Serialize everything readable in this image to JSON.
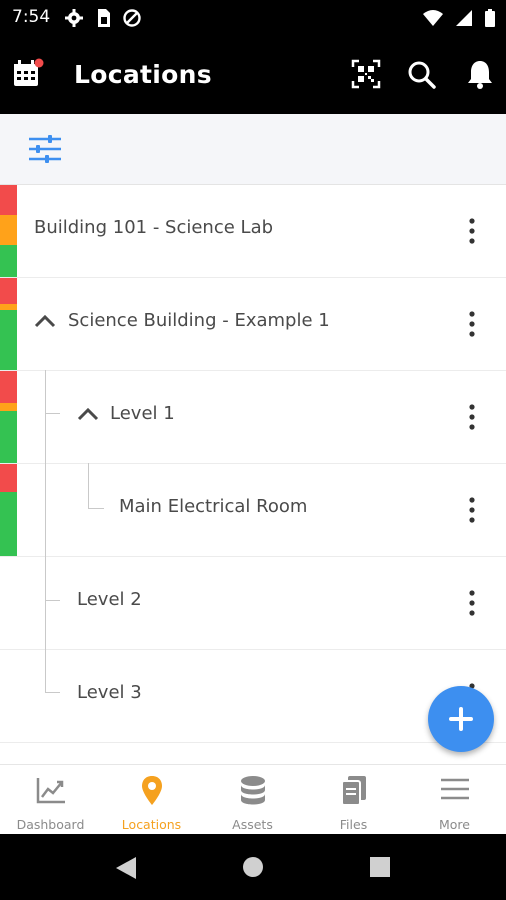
{
  "status_bar": {
    "time": "7:54"
  },
  "header": {
    "title": "Locations"
  },
  "locations": [
    {
      "label": "Building 101 - Science Lab"
    },
    {
      "label": "Science Building - Example 1"
    },
    {
      "label": "Level 1"
    },
    {
      "label": "Main Electrical Room"
    },
    {
      "label": "Level 2"
    },
    {
      "label": "Level 3"
    }
  ],
  "bottom_nav": [
    {
      "label": "Dashboard"
    },
    {
      "label": "Locations"
    },
    {
      "label": "Assets"
    },
    {
      "label": "Files"
    },
    {
      "label": "More"
    }
  ],
  "colors": {
    "red": "#f24b4b",
    "orange": "#ffa21a",
    "green": "#34c252",
    "fab_blue": "#3d8ff0",
    "active": "#f5a11f",
    "filter_blue": "#3d8ff0"
  }
}
